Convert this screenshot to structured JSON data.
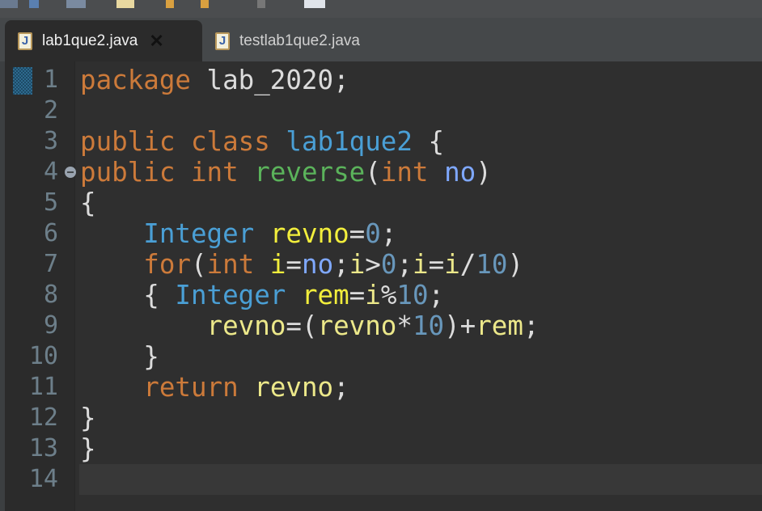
{
  "tabs": [
    {
      "label": "lab1que2.java",
      "icon": "java-file-icon",
      "active": true
    },
    {
      "label": "testlab1que2.java",
      "icon": "java-file-icon",
      "active": false
    }
  ],
  "editor": {
    "current_line": 14,
    "lines": [
      {
        "n": "1",
        "tokens": [
          {
            "t": "package",
            "c": "kw"
          },
          {
            "t": " lab_2020;",
            "c": "pl"
          }
        ]
      },
      {
        "n": "2",
        "tokens": []
      },
      {
        "n": "3",
        "tokens": [
          {
            "t": "public class",
            "c": "kw"
          },
          {
            "t": " ",
            "c": "pl"
          },
          {
            "t": "lab1que2",
            "c": "cls"
          },
          {
            "t": " {",
            "c": "pl"
          }
        ]
      },
      {
        "n": "4",
        "fold": true,
        "tokens": [
          {
            "t": "public int",
            "c": "kw"
          },
          {
            "t": " ",
            "c": "pl"
          },
          {
            "t": "reverse",
            "c": "mth"
          },
          {
            "t": "(",
            "c": "pl"
          },
          {
            "t": "int",
            "c": "kw"
          },
          {
            "t": " ",
            "c": "pl"
          },
          {
            "t": "no",
            "c": "prm"
          },
          {
            "t": ")",
            "c": "pl"
          }
        ]
      },
      {
        "n": "5",
        "tokens": [
          {
            "t": "{",
            "c": "pl"
          }
        ]
      },
      {
        "n": "6",
        "tokens": [
          {
            "t": "    ",
            "c": "pl"
          },
          {
            "t": "Integer",
            "c": "cls"
          },
          {
            "t": " ",
            "c": "pl"
          },
          {
            "t": "revno",
            "c": "lv"
          },
          {
            "t": "=",
            "c": "pl"
          },
          {
            "t": "0",
            "c": "num"
          },
          {
            "t": ";",
            "c": "pl"
          }
        ]
      },
      {
        "n": "7",
        "tokens": [
          {
            "t": "    ",
            "c": "pl"
          },
          {
            "t": "for",
            "c": "kw"
          },
          {
            "t": "(",
            "c": "pl"
          },
          {
            "t": "int",
            "c": "kw"
          },
          {
            "t": " ",
            "c": "pl"
          },
          {
            "t": "i",
            "c": "lv"
          },
          {
            "t": "=",
            "c": "pl"
          },
          {
            "t": "no",
            "c": "prm"
          },
          {
            "t": ";",
            "c": "pl"
          },
          {
            "t": "i",
            "c": "lvu"
          },
          {
            "t": ">",
            "c": "pl"
          },
          {
            "t": "0",
            "c": "num"
          },
          {
            "t": ";",
            "c": "pl"
          },
          {
            "t": "i",
            "c": "lvu"
          },
          {
            "t": "=",
            "c": "pl"
          },
          {
            "t": "i",
            "c": "lvu"
          },
          {
            "t": "/",
            "c": "pl"
          },
          {
            "t": "10",
            "c": "num"
          },
          {
            "t": ")",
            "c": "pl"
          }
        ]
      },
      {
        "n": "8",
        "tokens": [
          {
            "t": "    { ",
            "c": "pl"
          },
          {
            "t": "Integer",
            "c": "cls"
          },
          {
            "t": " ",
            "c": "pl"
          },
          {
            "t": "rem",
            "c": "lv"
          },
          {
            "t": "=",
            "c": "pl"
          },
          {
            "t": "i",
            "c": "lvu"
          },
          {
            "t": "%",
            "c": "pl"
          },
          {
            "t": "10",
            "c": "num"
          },
          {
            "t": ";",
            "c": "pl"
          }
        ]
      },
      {
        "n": "9",
        "tokens": [
          {
            "t": "        ",
            "c": "pl"
          },
          {
            "t": "revno",
            "c": "lvu"
          },
          {
            "t": "=(",
            "c": "pl"
          },
          {
            "t": "revno",
            "c": "lvu"
          },
          {
            "t": "*",
            "c": "pl"
          },
          {
            "t": "10",
            "c": "num"
          },
          {
            "t": ")+",
            "c": "pl"
          },
          {
            "t": "rem",
            "c": "lvu"
          },
          {
            "t": ";",
            "c": "pl"
          }
        ]
      },
      {
        "n": "10",
        "tokens": [
          {
            "t": "    }",
            "c": "pl"
          }
        ]
      },
      {
        "n": "11",
        "tokens": [
          {
            "t": "    ",
            "c": "pl"
          },
          {
            "t": "return",
            "c": "kw"
          },
          {
            "t": " ",
            "c": "pl"
          },
          {
            "t": "revno",
            "c": "lvu"
          },
          {
            "t": ";",
            "c": "pl"
          }
        ]
      },
      {
        "n": "12",
        "tokens": [
          {
            "t": "}",
            "c": "pl"
          }
        ]
      },
      {
        "n": "13",
        "tokens": [
          {
            "t": "}",
            "c": "pl"
          }
        ]
      },
      {
        "n": "14",
        "tokens": []
      }
    ]
  }
}
